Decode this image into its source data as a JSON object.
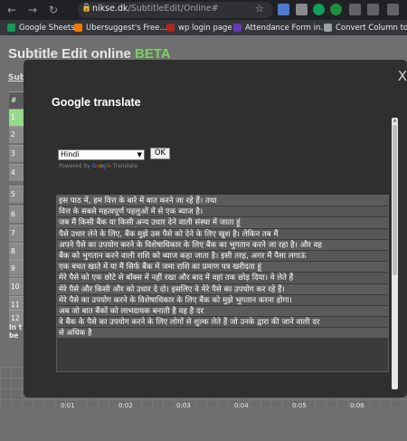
{
  "browser": {
    "url_host": "nikse.dk",
    "url_path": "/SubtitleEdit/Online#",
    "bookmarks": [
      {
        "label": "Google Sheets",
        "color": "#0f9d58"
      },
      {
        "label": "Ubersuggest's Free...",
        "color": "#f57c00"
      },
      {
        "label": "wp login page",
        "color": "#b3261e"
      },
      {
        "label": "Attendance Form in...",
        "color": "#673ab7"
      },
      {
        "label": "Convert Column to...",
        "color": "#9aa0a6"
      }
    ]
  },
  "page": {
    "title": "Subtitle Edit online",
    "title_beta": "BETA",
    "subtitle": "Subt",
    "grid_header": "#",
    "row_numbers": [
      "1",
      "2",
      "3",
      "4",
      "5",
      "6",
      "7",
      "8",
      "9",
      "10",
      "11",
      "12"
    ],
    "side_text_1": "In t",
    "side_text_2": "be",
    "timeline_ticks": [
      "0:01",
      "0:02",
      "0:03",
      "0:04",
      "0:05",
      "0:06"
    ]
  },
  "modal": {
    "title": "Google translate",
    "close_glyph": "X",
    "language_selected": "Hindi",
    "ok_label": "OK",
    "powered_by": "Powered by",
    "powered_translate": "Translate",
    "lines": [
      "इस पाठ में, हम वित्त के बारे में बात करने जा रहे हैं। तथा",
      "वित्त के सबसे महत्वपूर्ण पहलुओं में से एक ब्याज है।",
      "जब मैं किसी बैंक या किसी अन्य उधार देने वाली संस्था में जाता हूं",
      "पैसे उधार लेने के लिए, बैंक मुझे उस पैसे को देने के लिए खुश है। लेकिन तब मैं",
      "अपने पैसे का उपयोग करने के विशेषाधिकार के लिए बैंक का भुगतान करने जा रहा है। और वह",
      "बैंक को भुगतान करने वाली राशि को ब्याज कहा जाता है। इसी तरह, अगर मैं पैसा लगाऊं",
      "एक बचत खाते में या मैं सिर्फ बैंक में जमा राशि का प्रमाण पत्र खरीदता हूं",
      "मेरे पैसे को एक छोटे से बॉक्स में नहीं रखा और बाद में वहां तक छोड़ दिया। वे लेते हैं",
      "मेरे पैसे और किसी और को उधार दे दो। इसलिए वे मेरे पैसे का उपयोग कर रहे हैं।",
      "मेरे पैसे का उपयोग करने के विशेषाधिकार के लिए बैंक को मुझे भुगतान करना होगा।",
      "अब जो बात बैंकों को लाभदायक बनाती है वह है दर",
      "वे बैंक के पैसे का उपयोग करने के लिए लोगों से शुल्क लेते हैं जो उनके द्वारा की जाने वाली दर",
      "से अधिक है"
    ]
  }
}
